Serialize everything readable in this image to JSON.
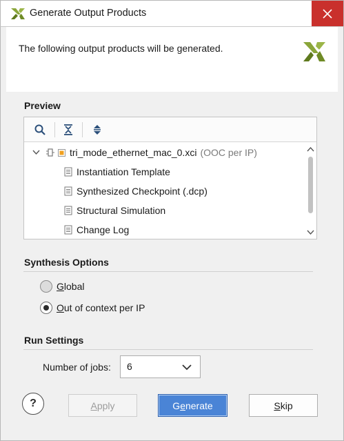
{
  "window": {
    "title": "Generate Output Products"
  },
  "header": {
    "message": "The following output products will be generated."
  },
  "preview": {
    "section_title": "Preview",
    "root": {
      "name": "tri_mode_ethernet_mac_0.xci",
      "suffix": "(OOC per IP)"
    },
    "children": [
      {
        "label": "Instantiation Template"
      },
      {
        "label": "Synthesized Checkpoint (.dcp)"
      },
      {
        "label": "Structural Simulation"
      },
      {
        "label": "Change Log"
      }
    ]
  },
  "synthesis": {
    "section_title": "Synthesis Options",
    "options": [
      {
        "pre": "",
        "mnemonic": "G",
        "post": "lobal",
        "selected": false
      },
      {
        "pre": "",
        "mnemonic": "O",
        "post": "ut of context per IP",
        "selected": true
      }
    ]
  },
  "run_settings": {
    "section_title": "Run Settings",
    "jobs_label_pre": "Number of ",
    "jobs_label_mnemonic": "j",
    "jobs_label_post": "obs:",
    "jobs_value": "6"
  },
  "buttons": {
    "help": "?",
    "apply": {
      "pre": "",
      "mnemonic": "A",
      "post": "pply"
    },
    "generate": {
      "pre": "G",
      "mnemonic": "e",
      "post": "nerate"
    },
    "skip": {
      "pre": "",
      "mnemonic": "S",
      "post": "kip"
    }
  },
  "colors": {
    "close_button": "#c9302c",
    "primary_button": "#4a84d6",
    "logo_green": "#7a9a2a"
  }
}
